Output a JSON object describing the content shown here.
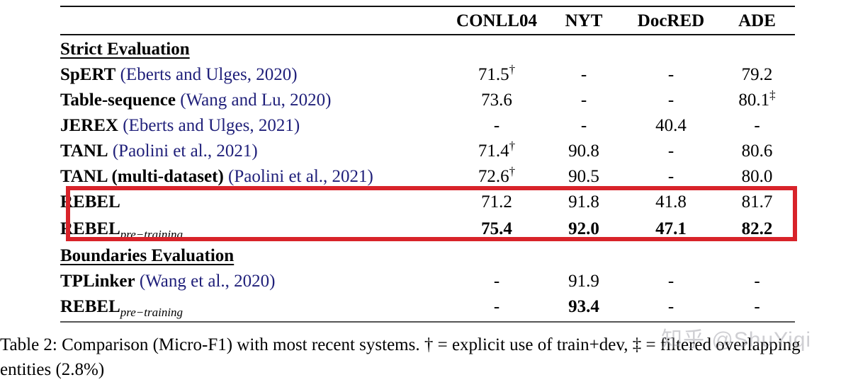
{
  "table": {
    "columns": [
      "",
      "CONLL04",
      "NYT",
      "DocRED",
      "ADE"
    ],
    "headers": {
      "label": "",
      "conll04": "CONLL04",
      "nyt": "NYT",
      "docred": "DocRED",
      "ade": "ADE"
    },
    "sections": [
      {
        "heading": "Strict Evaluation",
        "rows": [
          {
            "system": "SpERT",
            "citation": "(Eberts and Ulges, 2020)",
            "extra": "",
            "subscript": "",
            "conll04": "71.5",
            "conll04_mark": "†",
            "nyt": "-",
            "docred": "-",
            "ade": "79.2",
            "ade_mark": "",
            "bold_values": false
          },
          {
            "system": "Table-sequence",
            "citation": "(Wang and Lu, 2020)",
            "extra": "",
            "subscript": "",
            "conll04": "73.6",
            "conll04_mark": "",
            "nyt": "-",
            "docred": "-",
            "ade": "80.1",
            "ade_mark": "‡",
            "bold_values": false
          },
          {
            "system": "JEREX",
            "citation": "(Eberts and Ulges, 2021)",
            "extra": "",
            "subscript": "",
            "conll04": "-",
            "conll04_mark": "",
            "nyt": "-",
            "docred": "40.4",
            "ade": "-",
            "ade_mark": "",
            "bold_values": false
          },
          {
            "system": "TANL",
            "citation": "(Paolini et al., 2021)",
            "extra": "",
            "subscript": "",
            "conll04": "71.4",
            "conll04_mark": "†",
            "nyt": "90.8",
            "docred": "-",
            "ade": "80.6",
            "ade_mark": "",
            "bold_values": false
          },
          {
            "system": "TANL",
            "citation": "(Paolini et al., 2021)",
            "extra": " (multi-dataset) ",
            "subscript": "",
            "conll04": "72.6",
            "conll04_mark": "†",
            "nyt": "90.5",
            "docred": "-",
            "ade": "80.0",
            "ade_mark": "",
            "bold_values": false
          },
          {
            "system": "REBEL",
            "citation": "",
            "extra": "",
            "subscript": "",
            "conll04": "71.2",
            "conll04_mark": "",
            "nyt": "91.8",
            "docred": "41.8",
            "ade": "81.7",
            "ade_mark": "",
            "bold_values": false
          },
          {
            "system": "REBEL",
            "citation": "",
            "extra": "",
            "subscript": "pre−training",
            "conll04": "75.4",
            "conll04_mark": "",
            "nyt": "92.0",
            "docred": "47.1",
            "ade": "82.2",
            "ade_mark": "",
            "bold_values": true
          }
        ]
      },
      {
        "heading": "Boundaries Evaluation",
        "rows": [
          {
            "system": "TPLinker",
            "citation": "(Wang et al., 2020)",
            "extra": "",
            "subscript": "",
            "conll04": "-",
            "conll04_mark": "",
            "nyt": "91.9",
            "docred": "-",
            "ade": "-",
            "ade_mark": "",
            "bold_values": false
          },
          {
            "system": "REBEL",
            "citation": "",
            "extra": "",
            "subscript": "pre−training",
            "conll04": "-",
            "conll04_mark": "",
            "nyt": "93.4",
            "docred": "-",
            "ade": "-",
            "ade_mark": "",
            "bold_values": true
          }
        ]
      }
    ]
  },
  "highlight": {
    "color": "#d8232a",
    "covers": [
      "REBEL",
      "REBEL pre-training"
    ]
  },
  "caption": {
    "line1": "Table 2: Comparison (Micro-F1) with most recent systems. † = explicit use of train+dev, ‡ = filtered overlapping",
    "line2": "entities (2.8%)"
  },
  "watermark": {
    "text": "知乎 @ShuYiqi"
  }
}
